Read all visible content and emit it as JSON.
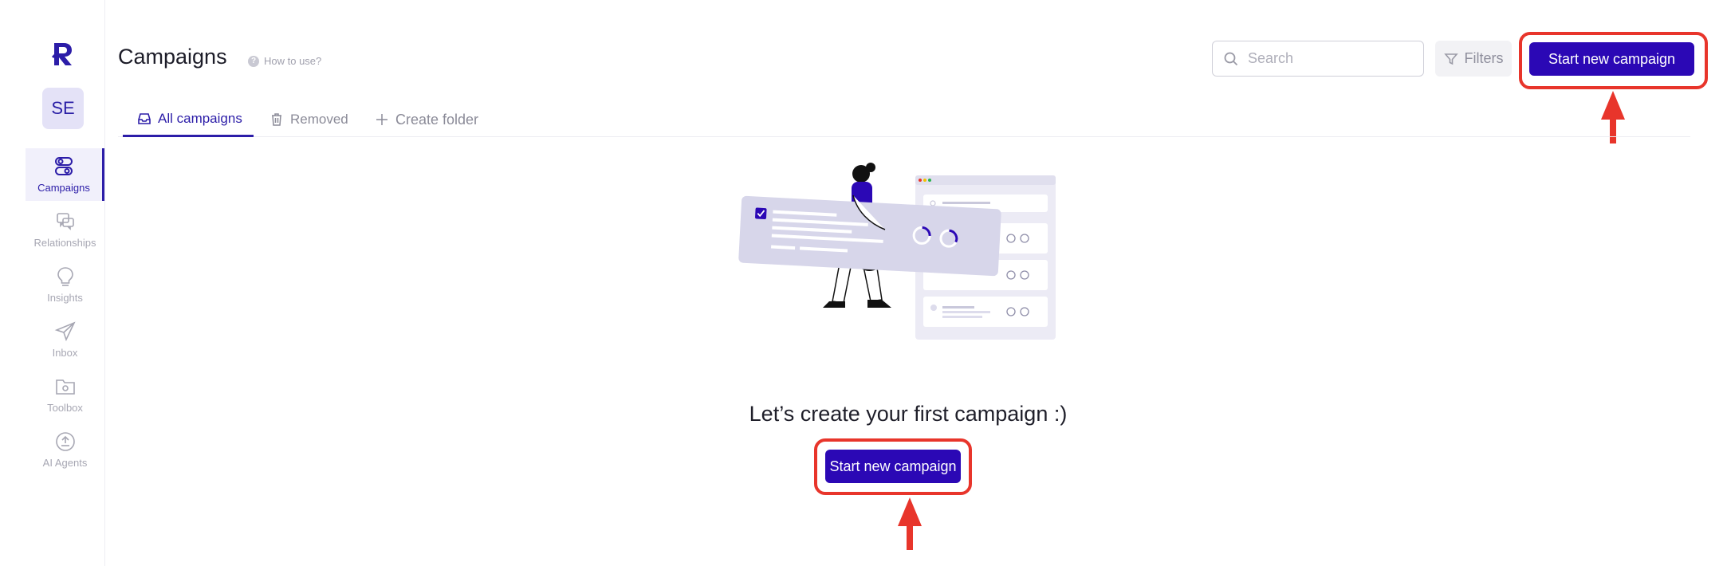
{
  "sidebar": {
    "avatar_initials": "SE",
    "items": [
      {
        "label": "Campaigns",
        "icon": "campaigns-icon",
        "active": true
      },
      {
        "label": "Relationships",
        "icon": "chat-bubbles-icon",
        "active": false
      },
      {
        "label": "Insights",
        "icon": "lightbulb-icon",
        "active": false
      },
      {
        "label": "Inbox",
        "icon": "send-icon",
        "active": false
      },
      {
        "label": "Toolbox",
        "icon": "folder-gear-icon",
        "active": false
      },
      {
        "label": "AI Agents",
        "icon": "ai-agent-icon",
        "active": false
      }
    ]
  },
  "header": {
    "title": "Campaigns",
    "how_to": "How to use?",
    "search_placeholder": "Search",
    "filters_label": "Filters",
    "start_button": "Start new campaign"
  },
  "tabs": [
    {
      "label": "All campaigns",
      "active": true
    },
    {
      "label": "Removed",
      "active": false
    },
    {
      "label": "Create folder",
      "active": false
    }
  ],
  "empty_state": {
    "title": "Let’s create your first campaign :)",
    "button": "Start new campaign"
  },
  "colors": {
    "accent": "#2b08b5",
    "highlight": "#e8352b"
  }
}
